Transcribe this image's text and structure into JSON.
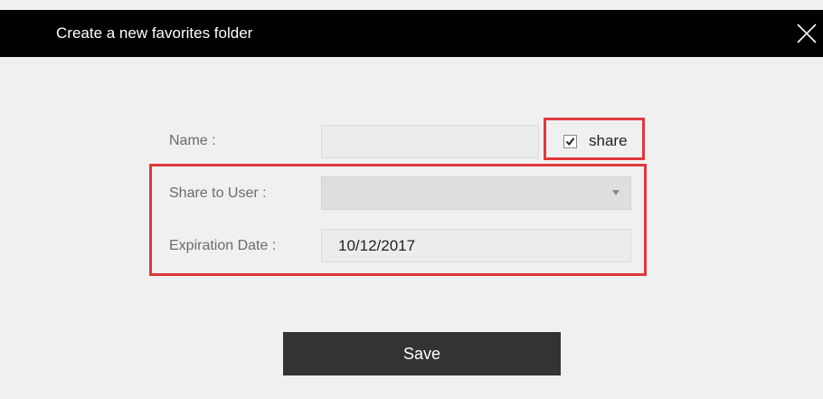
{
  "dialog": {
    "title": "Create a new favorites folder",
    "close_icon": "close-icon"
  },
  "form": {
    "name_label": "Name :",
    "name_value": "",
    "share_checked": true,
    "share_label": "share",
    "share_to_user_label": "Share to User :",
    "share_to_user_value": "",
    "expiration_label": "Expiration Date :",
    "expiration_value": "10/12/2017"
  },
  "actions": {
    "save_label": "Save"
  },
  "colors": {
    "titlebar": "#000000",
    "highlight": "#e0383c",
    "save_button": "#333333",
    "background": "#f0f0f0"
  }
}
